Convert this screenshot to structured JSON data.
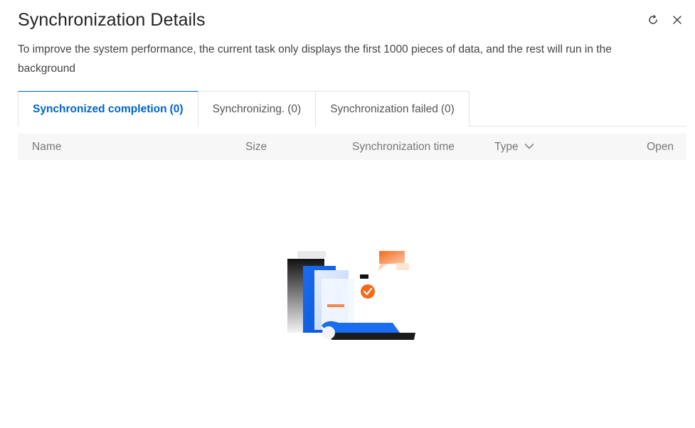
{
  "dialog": {
    "title": "Synchronization Details",
    "description": "To improve the system performance, the current task only displays the first 1000 pieces of data, and the rest will run in the background"
  },
  "header_icons": {
    "refresh": "refresh-icon",
    "close": "close-icon"
  },
  "tabs": [
    {
      "label": "Synchronized completion",
      "count": "(0)",
      "active": true
    },
    {
      "label": "Synchronizing.",
      "count": "(0)",
      "active": false
    },
    {
      "label": "Synchronization failed",
      "count": "(0)",
      "active": false
    }
  ],
  "table": {
    "columns": {
      "name": "Name",
      "size": "Size",
      "time": "Synchronization time",
      "type": "Type",
      "open": "Open"
    }
  },
  "colors": {
    "accent": "#0064c8",
    "illustration_blue": "#1a6cf0",
    "illustration_orange": "#f26b1d"
  }
}
